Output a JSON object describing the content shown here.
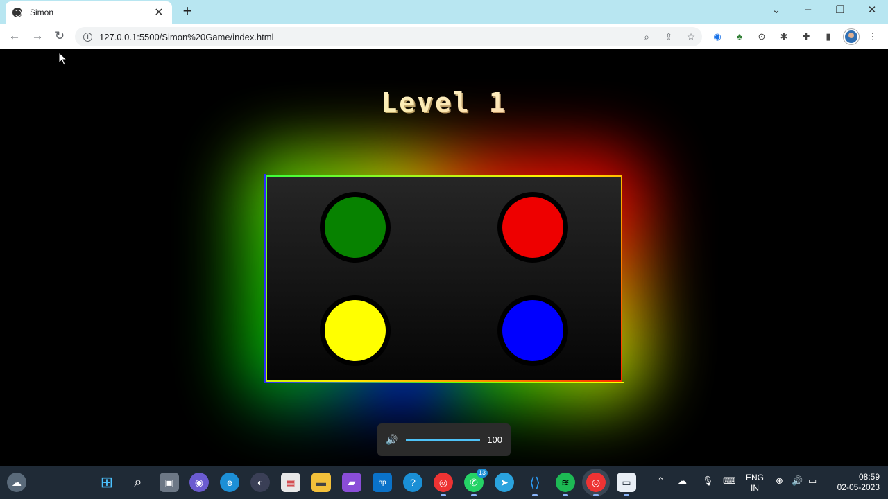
{
  "browser": {
    "tab_title": "Simon",
    "url": "127.0.0.1:5500/Simon%20Game/index.html"
  },
  "game": {
    "level_text": "Level 1",
    "pads": [
      {
        "name": "green",
        "color": "#078200"
      },
      {
        "name": "red",
        "color": "#ee0000"
      },
      {
        "name": "yellow",
        "color": "#ffff00"
      },
      {
        "name": "blue",
        "color": "#0000ff"
      }
    ]
  },
  "volume": {
    "value": 100,
    "label": "100"
  },
  "taskbar": {
    "language_line1": "ENG",
    "language_line2": "IN",
    "time": "08:59",
    "date": "02-05-2023",
    "whatsapp_badge": "13"
  }
}
